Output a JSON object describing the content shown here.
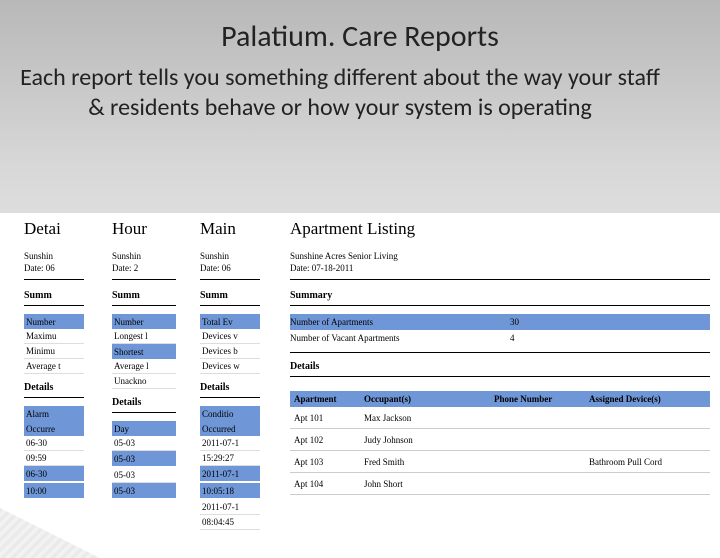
{
  "title": "Palatium. Care Reports",
  "subtitle": "Each report tells you something different about the way your staff & residents behave or how your system is operating",
  "r1": {
    "head": "Detai",
    "org": "Sunshin",
    "date": "Date:   06",
    "summary": "Summ",
    "h0": "Number",
    "rows": [
      "Maximu",
      "Minimu",
      "Average t"
    ],
    "details": "Details",
    "d0": "Alarm",
    "d1": "Occurre",
    "t0": "06-30",
    "t1": "09:59",
    "t2": "06-30",
    "t3": "10:00"
  },
  "r2": {
    "head": "Hour",
    "org": "Sunshin",
    "date": "Date:   2",
    "summary": "Summ",
    "h0": "Number",
    "rows": [
      "Longest l",
      "Shortest",
      "Average l",
      "Unackno"
    ],
    "details": "Details",
    "d0": "Day",
    "t0": "05-03",
    "t1": "05-03",
    "t2": "05-03",
    "t3": "05-03"
  },
  "r3": {
    "head": "Main",
    "org": "Sunshin",
    "date": "Date:   06",
    "summary": "Summ",
    "h0": "Total Ev",
    "rows": [
      "Devices v",
      "Devices b",
      "Devices w"
    ],
    "details": "Details",
    "d0": "Conditio",
    "d1": "Occurred",
    "t0": "2011-07-1",
    "t1": "15:29:27",
    "t2": "2011-07-1",
    "t3": "10:05:18",
    "t4": "2011-07-1",
    "t5": "08:04:45"
  },
  "r4": {
    "head": "Apartment Listing",
    "org": "Sunshine Acres Senior Living",
    "date": "Date:   07-18-2011",
    "summary": "Summary",
    "s0l": "Number of Apartments",
    "s0v": "30",
    "s1l": "Number of Vacant Apartments",
    "s1v": "4",
    "details": "Details",
    "hc0": "Apartment",
    "hc1": "Occupant(s)",
    "hc2": "Phone Number",
    "hc3": "Assigned Device(s)",
    "rows": [
      {
        "apt": "Apt 101",
        "occ": "Max Jackson",
        "phone": "",
        "dev": ""
      },
      {
        "apt": "Apt 102",
        "occ": "Judy Johnson",
        "phone": "",
        "dev": ""
      },
      {
        "apt": "Apt 103",
        "occ": "Fred Smith",
        "phone": "",
        "dev": "Bathroom Pull Cord"
      },
      {
        "apt": "Apt 104",
        "occ": "John Short",
        "phone": "",
        "dev": ""
      }
    ]
  }
}
